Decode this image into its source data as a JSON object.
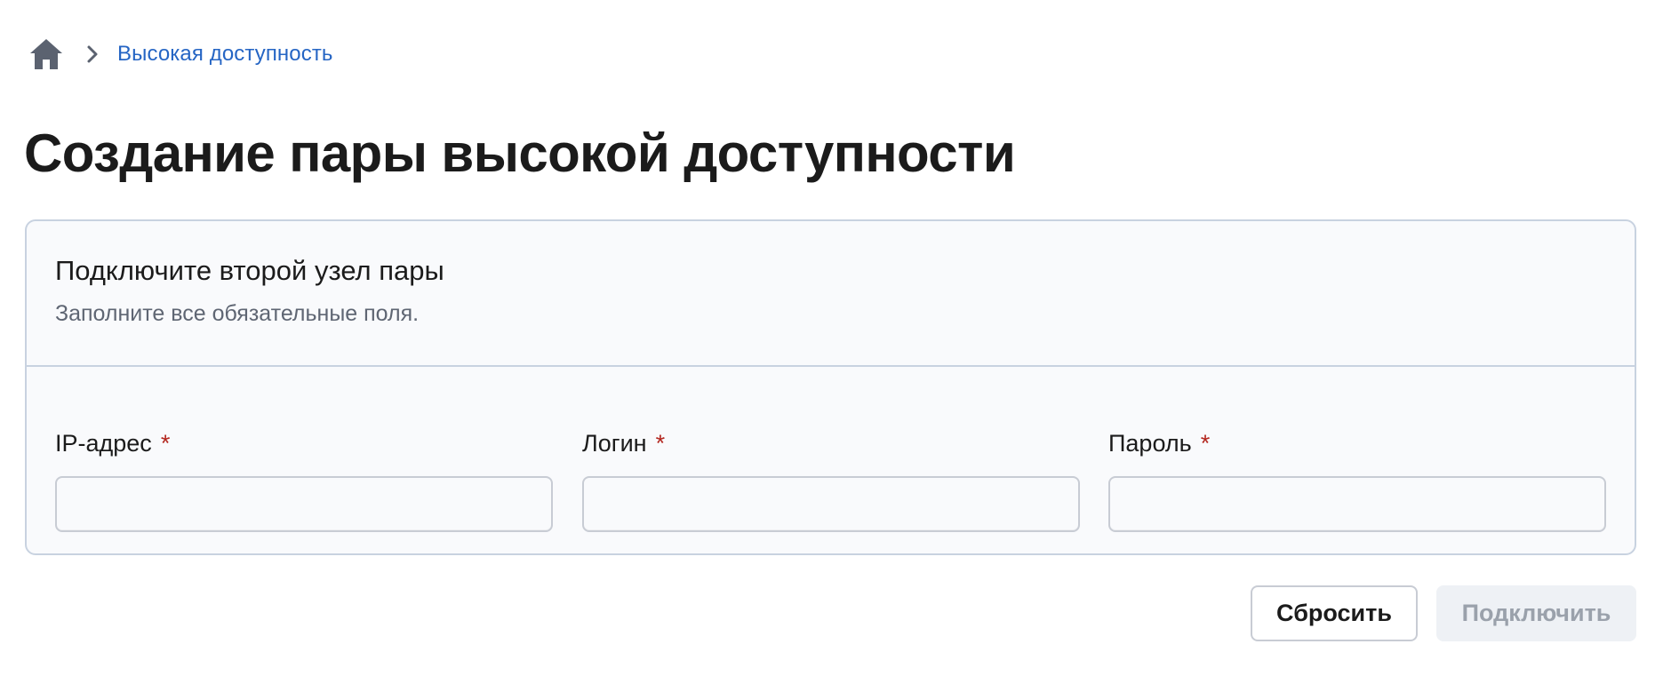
{
  "breadcrumb": {
    "home_icon": "home-icon",
    "separator_icon": "chevron-right-icon",
    "items": [
      {
        "label": "Высокая доступность"
      }
    ]
  },
  "page": {
    "title": "Создание пары высокой доступности"
  },
  "card": {
    "title": "Подключите второй узел пары",
    "subtitle": "Заполните все обязательные поля.",
    "fields": [
      {
        "label": "IP-адрес",
        "required_mark": "*",
        "value": "",
        "placeholder": ""
      },
      {
        "label": "Логин",
        "required_mark": "*",
        "value": "",
        "placeholder": ""
      },
      {
        "label": "Пароль",
        "required_mark": "*",
        "value": "",
        "placeholder": ""
      }
    ]
  },
  "actions": {
    "reset_label": "Сбросить",
    "connect_label": "Подключить",
    "connect_disabled": true
  },
  "colors": {
    "link": "#2565c4",
    "required": "#b3261e",
    "card_background": "#f9fafc",
    "border": "#c8d2e0",
    "disabled_button_background": "#eef1f5",
    "disabled_button_text": "#9aa1ab"
  }
}
